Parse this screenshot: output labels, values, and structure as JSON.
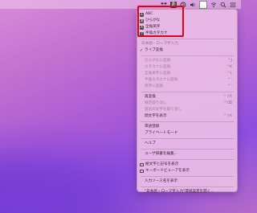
{
  "menubar": {
    "input_glyph": "あ",
    "icons": [
      "dropbox-icon",
      "input-method-icon",
      "sync-icon",
      "volume-icon",
      "battery-icon",
      "wifi-icon",
      "search-icon",
      "control-center-icon"
    ]
  },
  "menu": {
    "modes": [
      {
        "label": "ABC",
        "shortcut": "",
        "glyph": "A",
        "checked": false
      },
      {
        "label": "ひらがな",
        "shortcut": "",
        "glyph": "あ",
        "checked": true
      },
      {
        "label": "全角英字",
        "shortcut": "",
        "glyph": "Ａ",
        "checked": false
      },
      {
        "label": "半角カタカナ",
        "shortcut": "",
        "glyph": "ｱ",
        "checked": false
      }
    ],
    "section_header": "日本語・ローマ字入力",
    "live_conversion": "ライブ変換",
    "conversions": [
      {
        "label": "ひらがなに変換",
        "shortcut": "^J"
      },
      {
        "label": "カタカナに変換",
        "shortcut": "^K"
      },
      {
        "label": "全角英字に変換",
        "shortcut": "^L"
      },
      {
        "label": "半角カタカナに変換",
        "shortcut": "^;"
      },
      {
        "label": "英字に変換",
        "shortcut": "^:"
      }
    ],
    "reconversion": [
      {
        "label": "再変換",
        "shortcut": "^⇧R",
        "disabled": false
      },
      {
        "label": "確定取り消し",
        "shortcut": "^⌫",
        "disabled": true
      },
      {
        "label": "直前の文字を取り消し",
        "shortcut": "",
        "disabled": true
      },
      {
        "label": "顔文字を表示",
        "shortcut": "^⇧K",
        "disabled": false
      }
    ],
    "register": "単語登録",
    "private_mode": "プライベートモード",
    "help": "ヘルプ",
    "edit_dictionary": "ユーザ辞書を編集...",
    "show_emoji": "絵文字と記号を表示",
    "show_keyboard": "キーボードビューアを表示",
    "show_input_source_name": "入力ソース名を表示",
    "open_prefs": "\"日本語・ローマ字入力\"環境設定を開く..."
  }
}
